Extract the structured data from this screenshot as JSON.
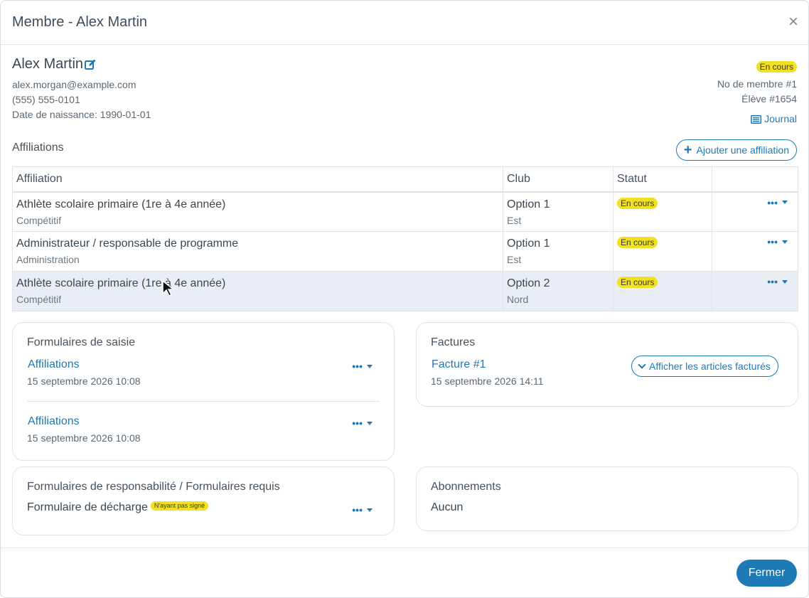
{
  "modal": {
    "title": "Membre - Alex Martin",
    "close": "×"
  },
  "member": {
    "name": "Alex Martin",
    "email": "alex.morgan@example.com",
    "phone": "(555) 555-0101",
    "birth": "Date de naissance: 1990-01-01",
    "status": "En cours",
    "member_no": "No de membre #1",
    "student_no": "Élève #1654",
    "journal": "Journal"
  },
  "affiliations": {
    "title": "Affiliations",
    "add_label": "Ajouter une affiliation",
    "columns": [
      "Affiliation",
      "Club",
      "Statut",
      ""
    ],
    "rows": [
      {
        "name": "Athlète scolaire primaire (1re à 4e année)",
        "category": "Compétitif",
        "club": "Option 1",
        "region": "Est",
        "status": "En cours",
        "menu": "•••"
      },
      {
        "name": "Administrateur / responsable de programme",
        "category": "Administration",
        "club": "Option 1",
        "region": "Est",
        "status": "En cours",
        "menu": "•••"
      },
      {
        "name": "Athlète scolaire primaire (1re à 4e année)",
        "category": "Compétitif",
        "club": "Option 2",
        "region": "Nord",
        "status": "En cours",
        "menu": "•••"
      }
    ]
  },
  "forms": {
    "title": "Formulaires de saisie",
    "items": [
      {
        "label": "Affiliations",
        "date": "15 septembre 2026 10:08",
        "menu": "•••"
      },
      {
        "label": "Affiliations",
        "date": "15 septembre 2026 10:08",
        "menu": "•••"
      }
    ]
  },
  "invoices": {
    "title": "Factures",
    "item_label": "Facture #1",
    "item_date": "15 septembre 2026 14:11",
    "show_items": "Afficher les articles facturés"
  },
  "waivers": {
    "title": "Formulaires de responsabilité / Formulaires requis",
    "item_label": "Formulaire de décharge",
    "item_badge": "N'ayant pas signé",
    "menu": "•••"
  },
  "subscriptions": {
    "title": "Abonnements",
    "value": "Aucun"
  },
  "footer": {
    "close_label": "Fermer"
  },
  "colors": {
    "accent": "#1e7ab4",
    "badge": "#f2e022",
    "row_highlight": "#e9eef5"
  }
}
